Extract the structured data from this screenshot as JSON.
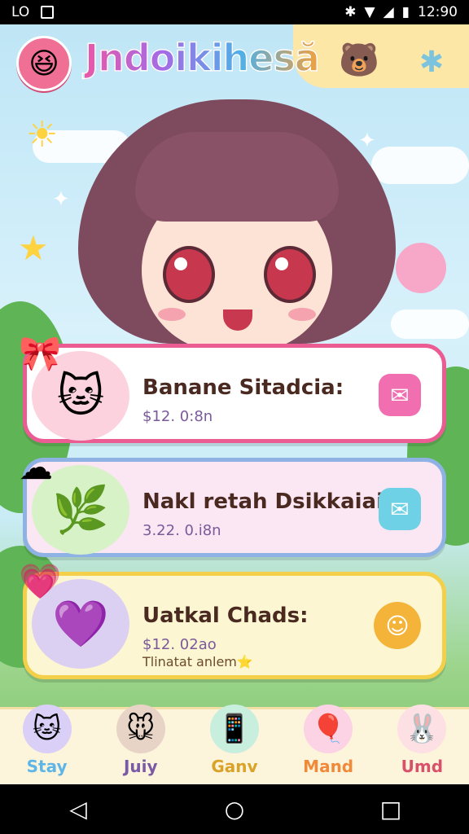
{
  "status_bar": {
    "left_icons": [
      "notification-icon",
      "photo-icon"
    ],
    "left_text": "LO",
    "time": "12:90"
  },
  "header": {
    "title": "Jndoikihesă",
    "avatar_icon": "laughing-face-icon",
    "settings_icon": "gear-icon"
  },
  "cards": [
    {
      "name": "Banane Sitadcia:",
      "price": "$12. 0:8n",
      "sub": ""
    },
    {
      "name": "Nakl retah Dsikkaiai:",
      "price": "3.22. 0.i8n",
      "sub": ""
    },
    {
      "name": "Uatkal Chads:",
      "price": "$12. 02ao",
      "sub": "Tlinatat anlem⭐"
    }
  ],
  "tabs": [
    {
      "label": "Stay",
      "color": "#5fb6e6",
      "icon": "cat-icon"
    },
    {
      "label": "Juiy",
      "color": "#7a5aa6",
      "icon": "mouse-icon"
    },
    {
      "label": "Ganv",
      "color": "#d9a32a",
      "icon": "phone-icon"
    },
    {
      "label": "Mand",
      "color": "#ef8a3a",
      "icon": "balloon-icon"
    },
    {
      "label": "Umd",
      "color": "#d8506a",
      "icon": "bunny-icon"
    }
  ],
  "colors": {
    "card1_border": "#ea5c92",
    "card2_border": "#8fb2e4",
    "card3_border": "#f3cf4a"
  }
}
